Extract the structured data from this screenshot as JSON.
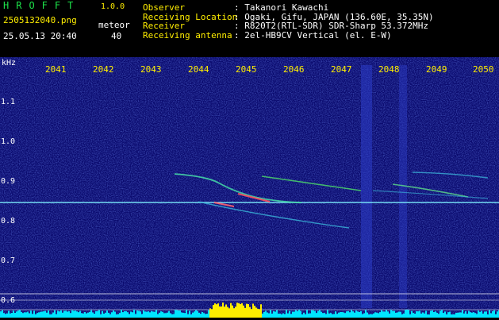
{
  "header": {
    "app_name": "HROFFT",
    "version": "1.0.0",
    "filename": "2505132040.png",
    "datetime": "25.05.13 20:40",
    "meteor_label": "meteor",
    "meteor_count": "40"
  },
  "info": [
    {
      "key": "Observer",
      "value": "Takanori Kawachi"
    },
    {
      "key": "Receiving Location",
      "value": "Ogaki, Gifu, JAPAN (136.60E, 35.35N)"
    },
    {
      "key": "Receiver",
      "value": "R820T2(RTL-SDR) SDR-Sharp 53.372MHz"
    },
    {
      "key": "Receiving antenna",
      "value": "2el-HB9CV Vertical (el. E-W)"
    }
  ],
  "axis": {
    "y_unit": "kHz",
    "x_ticks": [
      "2041",
      "2042",
      "2043",
      "2044",
      "2045",
      "2046",
      "2047",
      "2048",
      "2049",
      "2050"
    ],
    "y_ticks": [
      "1.1",
      "1.0",
      "0.9",
      "0.8",
      "0.7",
      "0.6"
    ]
  },
  "colors": {
    "accent_green": "#1de24a",
    "label_yellow": "#ffee00",
    "noise_bar": "#00e5ff",
    "background": "#0a0a6e"
  }
}
